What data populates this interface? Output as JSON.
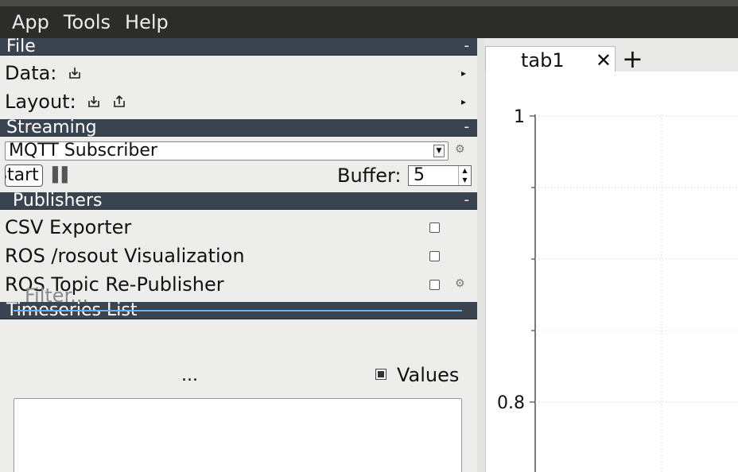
{
  "menubar": {
    "items": [
      "App",
      "Tools",
      "Help"
    ]
  },
  "file_section": {
    "title": "File",
    "collapse": "-",
    "data_label": "Data:",
    "layout_label": "Layout:"
  },
  "streaming_section": {
    "title": "Streaming",
    "collapse": "-",
    "source": "MQTT Subscriber",
    "start_label": "Start",
    "buffer_label": "Buffer:",
    "buffer_value": "5"
  },
  "publishers_section": {
    "title": "Publishers",
    "collapse": "-",
    "items": [
      {
        "label": "CSV Exporter",
        "has_settings": false
      },
      {
        "label": "ROS /rosout Visualization",
        "has_settings": false
      },
      {
        "label": "ROS Topic Re-Publisher",
        "has_settings": true
      }
    ]
  },
  "timeseries_section": {
    "title": "Timeseries List",
    "filter_placeholder": "Filter...",
    "ellipsis": "...",
    "values_label": "Values",
    "values_checked": true
  },
  "tabs": {
    "items": [
      "tab1"
    ],
    "close": "✕",
    "add": "+"
  },
  "plot": {
    "y_ticks": [
      "1",
      "0.8"
    ]
  },
  "colors": {
    "section_header": "#3a4450",
    "menubar": "#2c2d2b",
    "accent": "#6ab2ee"
  }
}
